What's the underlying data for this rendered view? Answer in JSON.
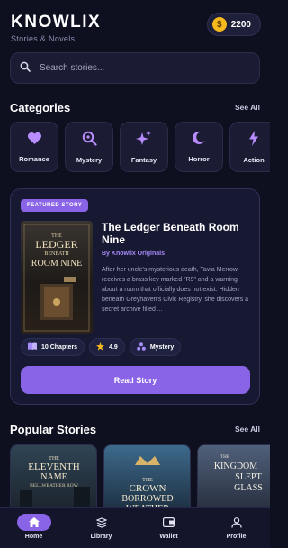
{
  "app": {
    "name": "KNOWLIX",
    "tagline": "Stories & Novels"
  },
  "wallet": {
    "coins": "2200"
  },
  "search": {
    "placeholder": "Search stories..."
  },
  "categories": {
    "title": "Categories",
    "see_all": "See All",
    "items": [
      {
        "label": "Romance",
        "icon": "heart-icon"
      },
      {
        "label": "Mystery",
        "icon": "magnifier-icon"
      },
      {
        "label": "Fantasy",
        "icon": "sparkles-icon"
      },
      {
        "label": "Horror",
        "icon": "moon-icon"
      },
      {
        "label": "Action",
        "icon": "lightning-icon"
      }
    ]
  },
  "featured": {
    "badge": "FEATURED STORY",
    "title": "The Ledger Beneath Room Nine",
    "author": "By Knowlix Originals",
    "description": "After her uncle's mysterious death, Tavia Merrow receives a brass key marked \"R9\" and a warning about a room that officially does not exist. Hidden beneath Greyhaven's Civic Registry, she discovers a secret archive filled ...",
    "cover_lines": [
      "THE",
      "LEDGER",
      "BENEATH",
      "ROOM NINE"
    ],
    "chapters": "10 Chapters",
    "rating": "4.9",
    "genre": "Mystery",
    "cta": "Read Story"
  },
  "popular": {
    "title": "Popular Stories",
    "see_all": "See All",
    "items": [
      {
        "cover_lines": [
          "THE",
          "ELEVENTH",
          "NAME",
          "BELLWEATHER ROW"
        ]
      },
      {
        "cover_lines": [
          "THE",
          "CROWN",
          "BORROWED",
          "WEATHER"
        ]
      },
      {
        "cover_lines": [
          "THE",
          "KINGDOM",
          "SLEPT",
          "GLASS"
        ]
      }
    ]
  },
  "nav": {
    "items": [
      {
        "label": "Home",
        "icon": "home-icon",
        "active": true
      },
      {
        "label": "Library",
        "icon": "library-icon",
        "active": false
      },
      {
        "label": "Wallet",
        "icon": "wallet-icon",
        "active": false
      },
      {
        "label": "Profile",
        "icon": "profile-icon",
        "active": false
      }
    ]
  },
  "colors": {
    "background": "#0e0f1f",
    "accent": "#8a64e6",
    "card": "#1b1c33",
    "coin": "#f5b91e"
  }
}
